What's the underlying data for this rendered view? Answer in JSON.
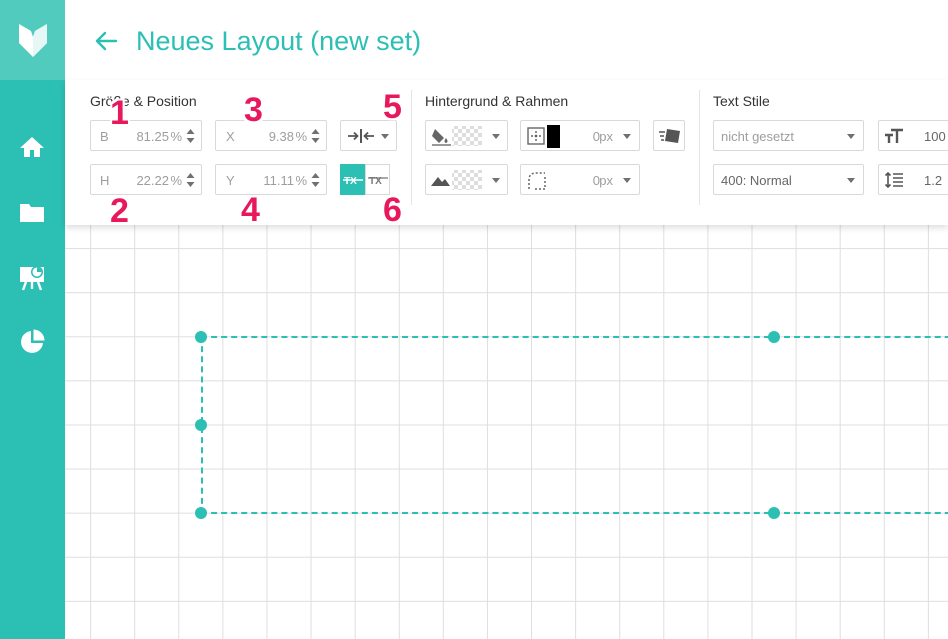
{
  "header": {
    "title": "Neues Layout (new set)"
  },
  "sidebar": {
    "items": [
      {
        "icon": "home-icon"
      },
      {
        "icon": "folder-icon"
      },
      {
        "icon": "presentation-icon"
      },
      {
        "icon": "pie-chart-icon"
      }
    ]
  },
  "toolbar": {
    "size_position": {
      "title": "Größe & Position",
      "width_label": "B",
      "width_value": "81.25",
      "height_label": "H",
      "height_value": "22.22",
      "x_label": "X",
      "x_value": "9.38",
      "y_label": "Y",
      "y_value": "11.11",
      "unit": "%"
    },
    "background_border": {
      "title": "Hintergrund & Rahmen",
      "border_width": "0",
      "border_radius": "0",
      "unit": "px",
      "border_color": "#000000"
    },
    "text_styles": {
      "title": "Text Stile",
      "font_family": "nicht gesetzt",
      "font_weight": "400: Normal",
      "font_size": "100",
      "line_height": "1.2"
    }
  },
  "annotations": [
    "1",
    "2",
    "3",
    "4",
    "5",
    "6"
  ],
  "colors": {
    "accent": "#2cbfb3",
    "badge": "#e8185c"
  }
}
